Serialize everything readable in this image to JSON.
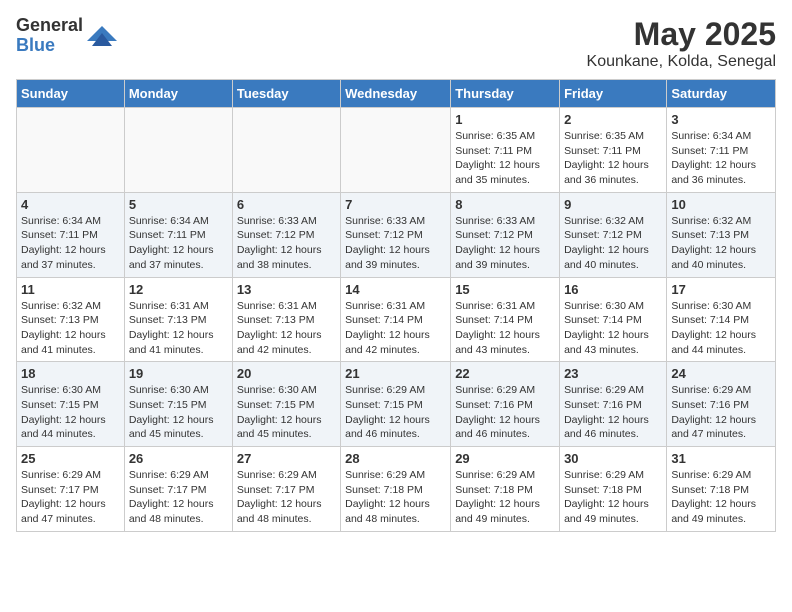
{
  "header": {
    "logo_general": "General",
    "logo_blue": "Blue",
    "month_year": "May 2025",
    "location": "Kounkane, Kolda, Senegal"
  },
  "days_of_week": [
    "Sunday",
    "Monday",
    "Tuesday",
    "Wednesday",
    "Thursday",
    "Friday",
    "Saturday"
  ],
  "weeks": [
    [
      {
        "day": "",
        "info": ""
      },
      {
        "day": "",
        "info": ""
      },
      {
        "day": "",
        "info": ""
      },
      {
        "day": "",
        "info": ""
      },
      {
        "day": "1",
        "info": "Sunrise: 6:35 AM\nSunset: 7:11 PM\nDaylight: 12 hours\nand 35 minutes."
      },
      {
        "day": "2",
        "info": "Sunrise: 6:35 AM\nSunset: 7:11 PM\nDaylight: 12 hours\nand 36 minutes."
      },
      {
        "day": "3",
        "info": "Sunrise: 6:34 AM\nSunset: 7:11 PM\nDaylight: 12 hours\nand 36 minutes."
      }
    ],
    [
      {
        "day": "4",
        "info": "Sunrise: 6:34 AM\nSunset: 7:11 PM\nDaylight: 12 hours\nand 37 minutes."
      },
      {
        "day": "5",
        "info": "Sunrise: 6:34 AM\nSunset: 7:11 PM\nDaylight: 12 hours\nand 37 minutes."
      },
      {
        "day": "6",
        "info": "Sunrise: 6:33 AM\nSunset: 7:12 PM\nDaylight: 12 hours\nand 38 minutes."
      },
      {
        "day": "7",
        "info": "Sunrise: 6:33 AM\nSunset: 7:12 PM\nDaylight: 12 hours\nand 39 minutes."
      },
      {
        "day": "8",
        "info": "Sunrise: 6:33 AM\nSunset: 7:12 PM\nDaylight: 12 hours\nand 39 minutes."
      },
      {
        "day": "9",
        "info": "Sunrise: 6:32 AM\nSunset: 7:12 PM\nDaylight: 12 hours\nand 40 minutes."
      },
      {
        "day": "10",
        "info": "Sunrise: 6:32 AM\nSunset: 7:13 PM\nDaylight: 12 hours\nand 40 minutes."
      }
    ],
    [
      {
        "day": "11",
        "info": "Sunrise: 6:32 AM\nSunset: 7:13 PM\nDaylight: 12 hours\nand 41 minutes."
      },
      {
        "day": "12",
        "info": "Sunrise: 6:31 AM\nSunset: 7:13 PM\nDaylight: 12 hours\nand 41 minutes."
      },
      {
        "day": "13",
        "info": "Sunrise: 6:31 AM\nSunset: 7:13 PM\nDaylight: 12 hours\nand 42 minutes."
      },
      {
        "day": "14",
        "info": "Sunrise: 6:31 AM\nSunset: 7:14 PM\nDaylight: 12 hours\nand 42 minutes."
      },
      {
        "day": "15",
        "info": "Sunrise: 6:31 AM\nSunset: 7:14 PM\nDaylight: 12 hours\nand 43 minutes."
      },
      {
        "day": "16",
        "info": "Sunrise: 6:30 AM\nSunset: 7:14 PM\nDaylight: 12 hours\nand 43 minutes."
      },
      {
        "day": "17",
        "info": "Sunrise: 6:30 AM\nSunset: 7:14 PM\nDaylight: 12 hours\nand 44 minutes."
      }
    ],
    [
      {
        "day": "18",
        "info": "Sunrise: 6:30 AM\nSunset: 7:15 PM\nDaylight: 12 hours\nand 44 minutes."
      },
      {
        "day": "19",
        "info": "Sunrise: 6:30 AM\nSunset: 7:15 PM\nDaylight: 12 hours\nand 45 minutes."
      },
      {
        "day": "20",
        "info": "Sunrise: 6:30 AM\nSunset: 7:15 PM\nDaylight: 12 hours\nand 45 minutes."
      },
      {
        "day": "21",
        "info": "Sunrise: 6:29 AM\nSunset: 7:15 PM\nDaylight: 12 hours\nand 46 minutes."
      },
      {
        "day": "22",
        "info": "Sunrise: 6:29 AM\nSunset: 7:16 PM\nDaylight: 12 hours\nand 46 minutes."
      },
      {
        "day": "23",
        "info": "Sunrise: 6:29 AM\nSunset: 7:16 PM\nDaylight: 12 hours\nand 46 minutes."
      },
      {
        "day": "24",
        "info": "Sunrise: 6:29 AM\nSunset: 7:16 PM\nDaylight: 12 hours\nand 47 minutes."
      }
    ],
    [
      {
        "day": "25",
        "info": "Sunrise: 6:29 AM\nSunset: 7:17 PM\nDaylight: 12 hours\nand 47 minutes."
      },
      {
        "day": "26",
        "info": "Sunrise: 6:29 AM\nSunset: 7:17 PM\nDaylight: 12 hours\nand 48 minutes."
      },
      {
        "day": "27",
        "info": "Sunrise: 6:29 AM\nSunset: 7:17 PM\nDaylight: 12 hours\nand 48 minutes."
      },
      {
        "day": "28",
        "info": "Sunrise: 6:29 AM\nSunset: 7:18 PM\nDaylight: 12 hours\nand 48 minutes."
      },
      {
        "day": "29",
        "info": "Sunrise: 6:29 AM\nSunset: 7:18 PM\nDaylight: 12 hours\nand 49 minutes."
      },
      {
        "day": "30",
        "info": "Sunrise: 6:29 AM\nSunset: 7:18 PM\nDaylight: 12 hours\nand 49 minutes."
      },
      {
        "day": "31",
        "info": "Sunrise: 6:29 AM\nSunset: 7:18 PM\nDaylight: 12 hours\nand 49 minutes."
      }
    ]
  ]
}
